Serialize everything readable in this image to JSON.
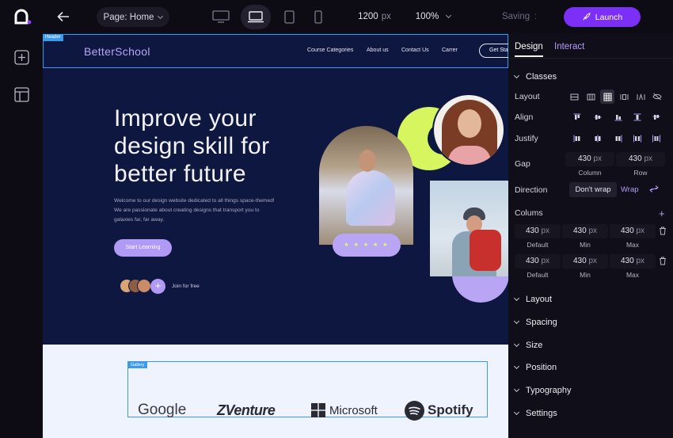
{
  "topbar": {
    "page_label": "Page: Home",
    "width_value": "1200",
    "width_unit": "px",
    "zoom": "100%",
    "saving_text": "Saving",
    "launch_label": "Launch"
  },
  "canvas": {
    "header_tag": "Header",
    "brand": "BetterSchool",
    "nav": [
      "Course Categories",
      "About us",
      "Contact Us",
      "Carrer"
    ],
    "nav_cta": "Get Sta",
    "hero_title_lines": [
      "Improve your",
      "design skill for",
      "better future"
    ],
    "hero_desc": "Welcome to our design website dedicated to all things space-themed! We are passionate about creating designs that transport you to galaxies far, far away.",
    "start_button": "Start Learning",
    "join_text": "Join for free",
    "rating_stars": "★ ★ ★ ★ ★",
    "gallery_tag": "Gallery",
    "logos": [
      "Google",
      "Venture",
      "Microsoft",
      "Spotify"
    ]
  },
  "panel": {
    "tabs": [
      "Design",
      "Interact"
    ],
    "classes": "Classes",
    "layout_label": "Layout",
    "align_label": "Align",
    "justify_label": "Justify",
    "gap_label": "Gap",
    "gap_column_value": "430",
    "gap_row_value": "430",
    "unit": "px",
    "gap_column_sub": "Column",
    "gap_row_sub": "Row",
    "direction_label": "Direction",
    "direction_nowrap": "Don't wrap",
    "direction_wrap": "Wrap",
    "columns_label": "Colums",
    "columns_rows": [
      {
        "values": [
          "430",
          "430",
          "430"
        ],
        "subs": [
          "Default",
          "Min",
          "Max"
        ]
      },
      {
        "values": [
          "430",
          "430",
          "430"
        ],
        "subs": [
          "Default",
          "Min",
          "Max"
        ]
      }
    ],
    "sections": [
      "Layout",
      "Spacing",
      "Size",
      "Position",
      "Typography",
      "Settings"
    ]
  },
  "colors": {
    "accent": "#7b2ff7",
    "canvas_bg": "#0e1740",
    "lime": "#d6f55e",
    "lavender": "#b8a6f5",
    "selection_blue": "#3b9bea",
    "tab_active": "#b69dfb"
  }
}
